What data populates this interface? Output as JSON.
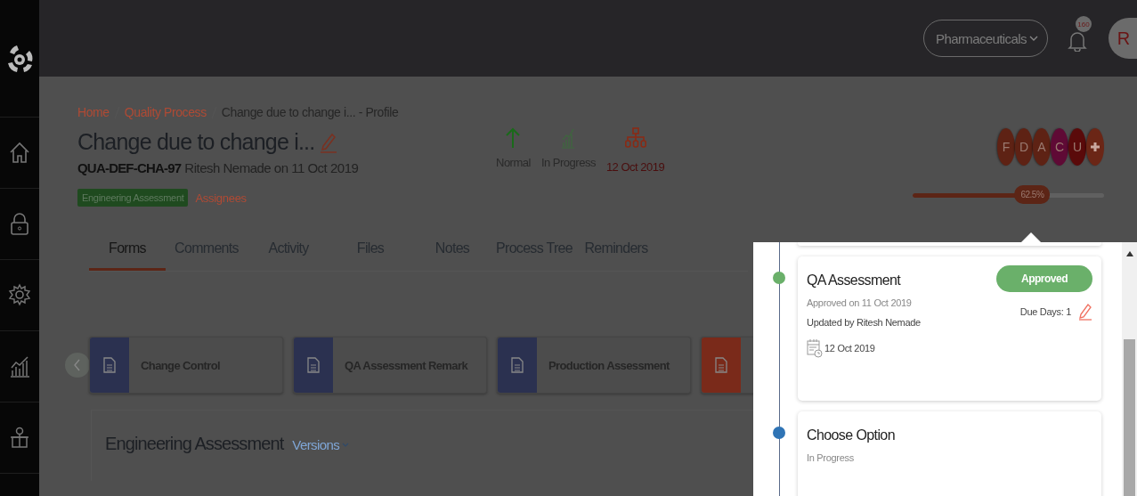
{
  "header": {
    "organization": "Pharmaceuticals",
    "notification_count": "160",
    "avatar_initial": "R"
  },
  "breadcrumb": [
    {
      "label": "Home",
      "link": true
    },
    {
      "label": "Quality Process",
      "link": true
    },
    {
      "label": "Change due to change i... - Profile",
      "link": false
    }
  ],
  "record": {
    "title": "Change due to change i...",
    "code": "QUA-DEF-CHA-97",
    "created": "Ritesh Nemade on 11 Oct 2019",
    "stage": "Engineering Assessment",
    "assignees_link": "Assignees"
  },
  "status_items": [
    {
      "kind": "priority",
      "label": "Normal"
    },
    {
      "kind": "status",
      "label": "In Progress"
    },
    {
      "kind": "due",
      "label": "12 Oct 2019"
    }
  ],
  "assignees": [
    {
      "kind": "person",
      "initial": "F",
      "color": "#5e2214"
    },
    {
      "kind": "person",
      "initial": "D",
      "color": "#5e2214"
    },
    {
      "kind": "person",
      "initial": "A",
      "color": "#5e2214"
    },
    {
      "kind": "person",
      "initial": "C",
      "color": "#5f0a35"
    },
    {
      "kind": "person",
      "initial": "U",
      "color": "#5a0a0a"
    },
    {
      "kind": "add",
      "color": "#6b2616"
    }
  ],
  "progress": {
    "level": 0.625,
    "reading": "62.5%"
  },
  "tabs": [
    {
      "label": "Forms",
      "selected": true
    },
    {
      "label": "Comments",
      "selected": false
    },
    {
      "label": "Activity",
      "selected": false
    },
    {
      "label": "Files",
      "selected": false
    },
    {
      "label": "Notes",
      "selected": false
    },
    {
      "label": "Process Tree",
      "selected": false
    },
    {
      "label": "Reminders",
      "selected": false
    }
  ],
  "forms": [
    {
      "label": "Change Control",
      "color": "#2b3150"
    },
    {
      "label": "QA Assessment Remark",
      "color": "#2b3150"
    },
    {
      "label": "Production Assessment",
      "color": "#2b3150"
    },
    {
      "color": "#7a2a1a"
    }
  ],
  "section": {
    "title": "Engineering Assessment",
    "versions": "Versions"
  },
  "timeline": [
    {
      "title": "QA Assessment",
      "subtitle": "Approved on 11 Oct 2019",
      "updated_by": "Updated by Ritesh Nemade",
      "date": "12 Oct 2019",
      "badge": "Approved",
      "due": "Due Days: 1",
      "color": "#6ab06a"
    },
    {
      "title": "Choose Option",
      "subtitle": "In Progress",
      "color": "#2f74b5"
    }
  ]
}
